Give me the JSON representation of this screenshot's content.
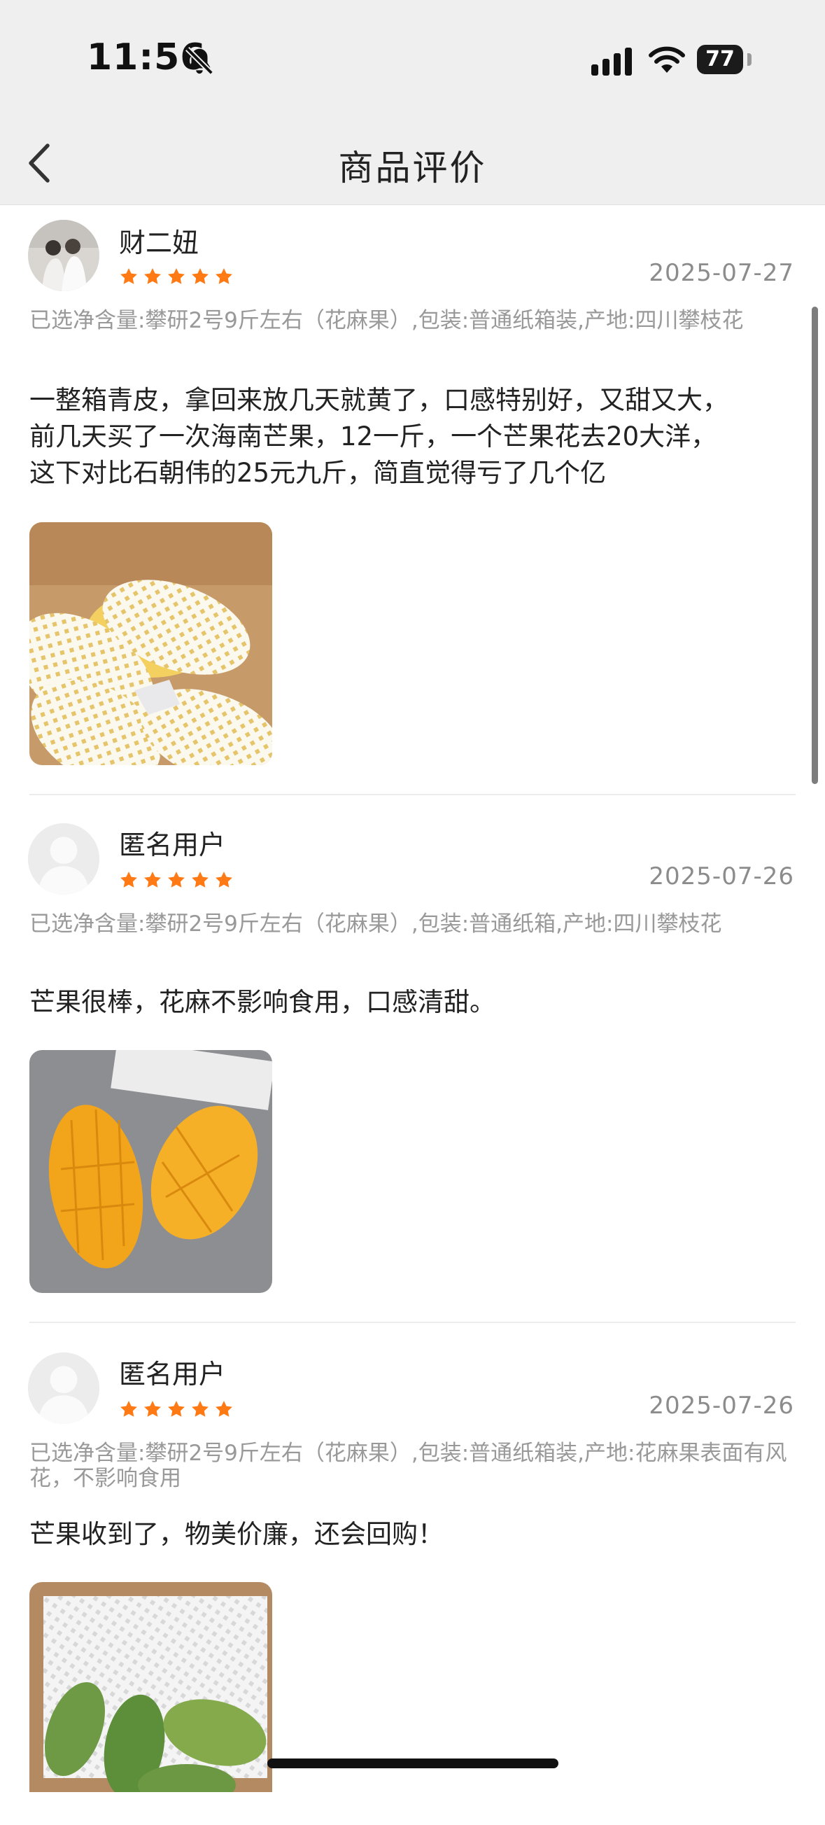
{
  "status_bar": {
    "time": "11:56",
    "battery": "77",
    "icons": [
      "bell-slash-icon",
      "cellular-signal-icon",
      "wifi-icon",
      "battery-icon"
    ]
  },
  "nav": {
    "title": "商品评价",
    "back_icon": "chevron-left-icon"
  },
  "colors": {
    "star": "#ff7a14",
    "date": "#8c8c8c",
    "spec": "#999999"
  },
  "reviews": [
    {
      "username": "财二妞",
      "rating": 5,
      "date": "2025-07-27",
      "spec": "已选净含量:攀研2号9斤左右（花麻果）,包装:普通纸箱装,产地:四川攀枝花",
      "lines": [
        "一整箱青皮，拿回来放几天就黄了，口感特别好，又甜又大，",
        "前几天买了一次海南芒果，12一斤，一个芒果花去20大洋，",
        "这下对比石朝伟的25元九斤，简直觉得亏了几个亿"
      ],
      "photo": "boxed mangoes in white foam nets"
    },
    {
      "username": "匿名用户",
      "rating": 5,
      "date": "2025-07-26",
      "spec": "已选净含量:攀研2号9斤左右（花麻果）,包装:普通纸箱,产地:四川攀枝花",
      "lines": [
        "芒果很棒，花麻不影响食用，口感清甜。"
      ],
      "photo": "cut mango halves"
    },
    {
      "username": "匿名用户",
      "rating": 5,
      "date": "2025-07-26",
      "spec": "已选净含量:攀研2号9斤左右（花麻果）,包装:普通纸箱装,产地:花麻果表面有风花，不影响食用",
      "lines": [
        "芒果收到了，物美价廉，还会回购！"
      ],
      "photo": "green mangoes in box"
    }
  ]
}
